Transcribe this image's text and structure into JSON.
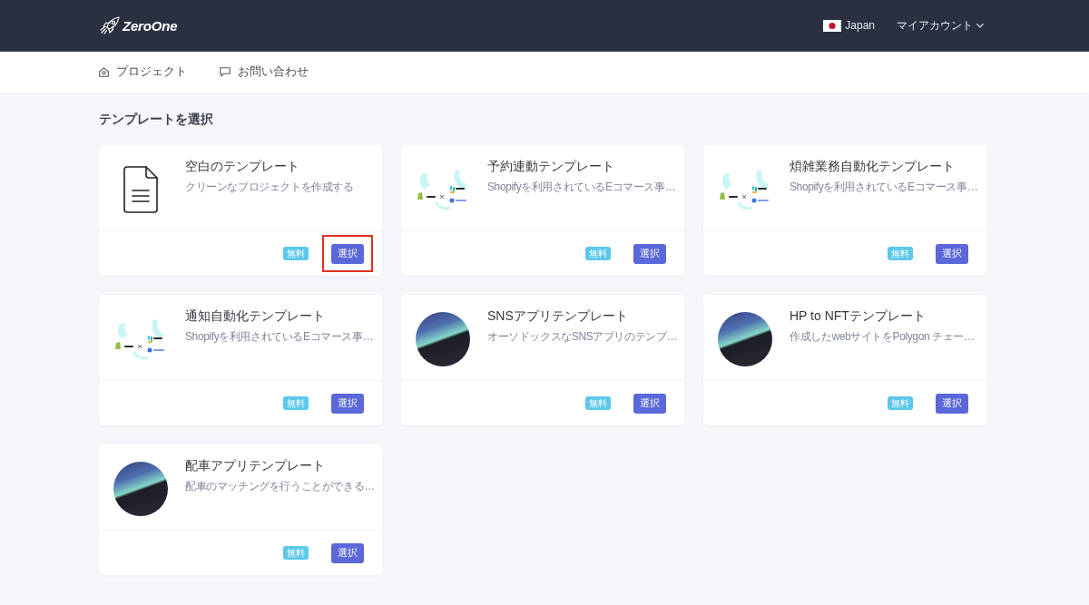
{
  "header": {
    "logo": "ZeroOne",
    "language": "Japan",
    "account_menu": "マイアカウント"
  },
  "nav": {
    "projects": "プロジェクト",
    "contact": "お問い合わせ"
  },
  "page_title": "テンプレートを選択",
  "templates": [
    {
      "kind": "document",
      "title": "空白のテンプレート",
      "description": "クリーンなプロジェクトを作成する",
      "badge": "無料",
      "button": "選択",
      "highlighted": true
    },
    {
      "kind": "logos",
      "title": "予約連動テンプレート",
      "description": "Shopifyを利用されているEコマース事…",
      "badge": "無料",
      "button": "選択",
      "highlighted": false
    },
    {
      "kind": "logos",
      "title": "煩雑業務自動化テンプレート",
      "description": "Shopifyを利用されているEコマース事…",
      "badge": "無料",
      "button": "選択",
      "highlighted": false
    },
    {
      "kind": "logos",
      "title": "通知自動化テンプレート",
      "description": "Shopifyを利用されているEコマース事…",
      "badge": "無料",
      "button": "選択",
      "highlighted": false
    },
    {
      "kind": "screenshot",
      "title": "SNSアプリテンプレート",
      "description": "オーソドックスなSNSアプリのテンプ…",
      "badge": "無料",
      "button": "選択",
      "highlighted": false
    },
    {
      "kind": "screenshot",
      "title": "HP to NFTテンプレート",
      "description": "作成したwebサイトをPolygon チェー…",
      "badge": "無料",
      "button": "選択",
      "highlighted": false
    },
    {
      "kind": "screenshot",
      "title": "配車アプリテンプレート",
      "description": "配車のマッチングを行うことができる…",
      "badge": "無料",
      "button": "選択",
      "highlighted": false
    }
  ]
}
